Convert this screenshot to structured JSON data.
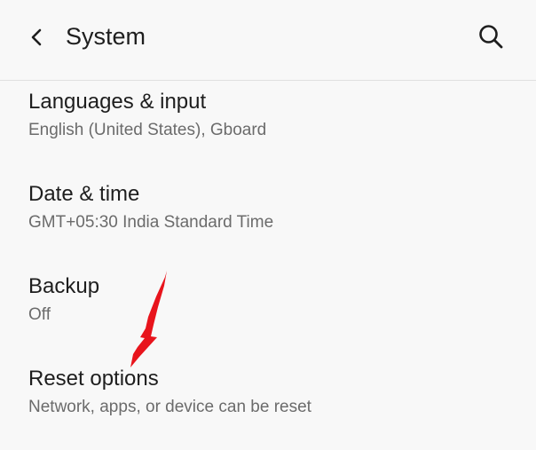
{
  "header": {
    "title": "System",
    "back_icon": "back-arrow-icon",
    "search_icon": "search-icon"
  },
  "settings": [
    {
      "title": "Languages & input",
      "summary": "English (United States), Gboard"
    },
    {
      "title": "Date & time",
      "summary": "GMT+05:30 India Standard Time"
    },
    {
      "title": "Backup",
      "summary": "Off"
    },
    {
      "title": "Reset options",
      "summary": "Network, apps, or device can be reset"
    }
  ],
  "colors": {
    "background": "#f8f8f8",
    "primary_text": "#1e1e1e",
    "secondary_text": "#6b6b6b",
    "annotation_arrow": "#e8141c"
  }
}
